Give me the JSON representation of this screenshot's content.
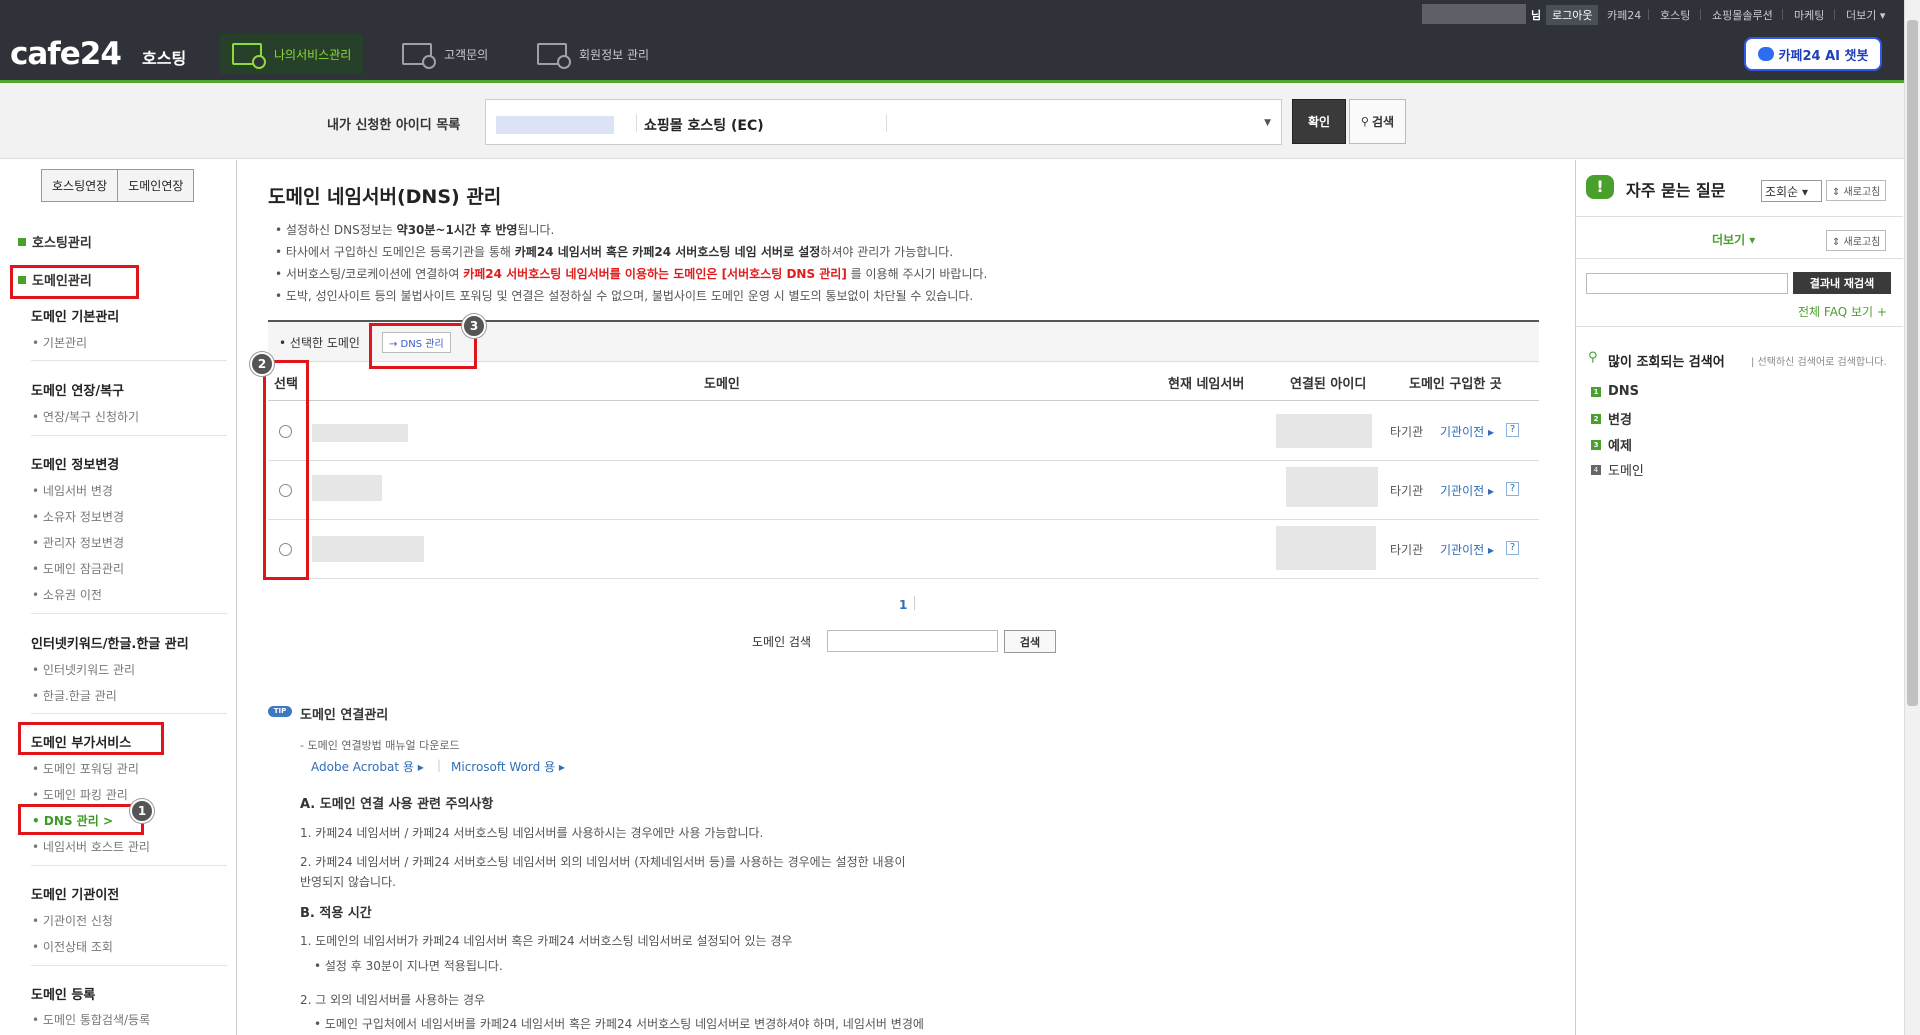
{
  "topbar": {
    "user_suffix": "님",
    "links": [
      "로그아웃",
      "카페24",
      "호스팅",
      "쇼핑몰솔루션",
      "마케팅",
      "더보기 ▾"
    ]
  },
  "header": {
    "logo": "cafe24",
    "logo_sub": "호스팅",
    "nav": [
      {
        "label": "나의서비스관리",
        "icon": "monitor-gear-icon",
        "active": true
      },
      {
        "label": "고객문의",
        "icon": "monitor-chat-icon",
        "active": false
      },
      {
        "label": "회원정보 관리",
        "icon": "monitor-user-icon",
        "active": false
      }
    ],
    "chatbot": "카페24 AI 챗봇",
    "accent": "#55a630"
  },
  "idbar": {
    "label": "내가 신청한 아이디 목록",
    "selected": "쇼핑몰 호스팅 (EC)",
    "confirm": "확인",
    "search": "검색"
  },
  "sidebar": {
    "tabs": [
      "호스팅연장",
      "도메인연장"
    ],
    "top_hosting": "호스팅관리",
    "top_domain": "도메인관리",
    "groups": [
      {
        "title": "도메인 기본관리",
        "items": [
          "기본관리"
        ]
      },
      {
        "title": "도메인 연장/복구",
        "items": [
          "연장/복구 신청하기"
        ]
      },
      {
        "title": "도메인 정보변경",
        "items": [
          "네임서버 변경",
          "소유자 정보변경",
          "관리자 정보변경",
          "도메인 잠금관리",
          "소유권 이전"
        ]
      },
      {
        "title": "인터넷키워드/한글.한글 관리",
        "items": [
          "인터넷키워드 관리",
          "한글.한글 관리"
        ]
      },
      {
        "title": "도메인 부가서비스",
        "items": [
          "도메인 포워딩 관리",
          "도메인 파킹 관리",
          "DNS 관리 >",
          "네임서버 호스트 관리"
        ]
      },
      {
        "title": "도메인 기관이전",
        "items": [
          "기관이전 신청",
          "이전상태 조회"
        ]
      },
      {
        "title": "도메인 등록",
        "items": [
          "도메인 통합검색/등록"
        ]
      }
    ]
  },
  "main": {
    "title": "도메인 네임서버(DNS) 관리",
    "notes": [
      {
        "pre": "설정하신 DNS정보는 ",
        "bold": "약30분~1시간 후 반영",
        "post": "됩니다."
      },
      {
        "pre": "타사에서 구입하신 도메인은 등록기관을 통해 ",
        "bold": "카페24 네임서버 혹은 카페24 서버호스팅 네임 서버로 설정",
        "post": "하셔야 관리가 가능합니다."
      },
      {
        "pre": "서버호스팅/코로케이션에 연결하여 ",
        "red": "카페24 서버호스팅 네임서버를 이용하는 도메인은 [서버호스팅 DNS 관리]",
        "post": " 를 이용해 주시기 바랍니다."
      },
      {
        "pre": "도박, 성인사이트 등의 불법사이트 포워딩 및 연결은 설정하실 수 없으며, 불법사이트 도메인 운영 시 별도의 통보없이 차단될 수 있습니다.",
        "bold": "",
        "post": ""
      }
    ],
    "selected_label": "선택한 도메인",
    "dns_button": "→ DNS 관리",
    "table": {
      "headers": [
        "선택",
        "도메인",
        "현재 네임서버",
        "연결된 아이디",
        "도메인 구입한 곳"
      ],
      "rows": [
        {
          "org": "타기관",
          "transfer": "기관이전 ▸",
          "help": "?"
        },
        {
          "org": "타기관",
          "transfer": "기관이전 ▸",
          "help": "?"
        },
        {
          "org": "타기관",
          "transfer": "기관이전 ▸",
          "help": "?"
        }
      ]
    },
    "page": "1",
    "domain_search_label": "도메인 검색",
    "domain_search_button": "검색",
    "tip_badge": "TIP",
    "tip_title": "도메인 연결관리",
    "manual": "- 도메인 연결방법 매뉴얼 다운로드",
    "acrobat": "Adobe Acrobat 용 ▸",
    "word": "Microsoft Word 용 ▸",
    "sec_a": "A. 도메인 연결 사용 관련 주의사항",
    "a1": "1. 카페24 네임서버 / 카페24 서버호스팅 네임서버를 사용하시는 경우에만 사용 가능합니다.",
    "a2_1": "2. 카페24 네임서버 / 카페24 서버호스팅 네임서버 외의 네임서버 (자체네임서버 등)를 사용하는 경우에는 설정한 내용이",
    "a2_2": "반영되지 않습니다.",
    "sec_b": "B. 적용 시간",
    "b1": "1. 도메인의 네임서버가 카페24 네임서버 혹은 카페24 서버호스팅 네임서버로 설정되어 있는 경우",
    "b1_sub": "• 설정 후 30분이 지나면 적용됩니다.",
    "b2": "2. 그 외의 네임서버를 사용하는 경우",
    "b2_sub": "• 도메인 구입처에서 네임서버를 카페24 네임서버 혹은 카페24 서버호스팅 네임서버로 변경하셔야 하며, 네임서버 변경에"
  },
  "faq": {
    "title": "자주 묻는 질문",
    "sort": "조회순",
    "refresh": "⇕ 새로고침",
    "more": "더보기 ▾",
    "result_search": "결과내 재검색",
    "all_faq": "전체 FAQ 보기 +",
    "popular_title": "많이 조회되는 검색어",
    "popular_desc": "| 선택하신 검색어로 검색합니다.",
    "keywords": [
      "DNS",
      "변경",
      "예제",
      "도메인"
    ]
  },
  "annotations": [
    "1",
    "2",
    "3"
  ]
}
